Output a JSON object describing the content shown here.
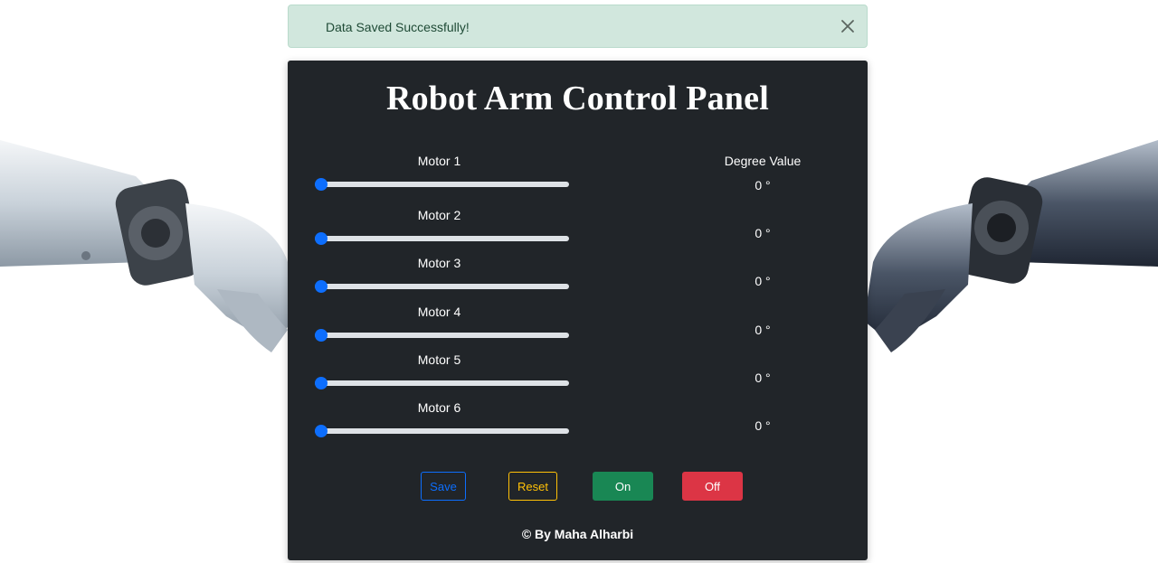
{
  "alert": {
    "message": "Data Saved Successfully!",
    "close_icon": "close-icon"
  },
  "panel": {
    "title": "Robot Arm Control Panel",
    "degree_header": "Degree Value",
    "motors": [
      {
        "label": "Motor 1",
        "degree": "0 °",
        "value": 0
      },
      {
        "label": "Motor 2",
        "degree": "0 °",
        "value": 0
      },
      {
        "label": "Motor 3",
        "degree": "0 °",
        "value": 0
      },
      {
        "label": "Motor 4",
        "degree": "0 °",
        "value": 0
      },
      {
        "label": "Motor 5",
        "degree": "0 °",
        "value": 0
      },
      {
        "label": "Motor 6",
        "degree": "0 °",
        "value": 0
      }
    ],
    "buttons": {
      "save": "Save",
      "reset": "Reset",
      "on": "On",
      "off": "Off"
    },
    "footer": "© By Maha Alharbi"
  },
  "colors": {
    "alert_bg": "#d1e7dd",
    "panel_bg": "#212529",
    "primary": "#0d6efd",
    "warning": "#ffc107",
    "success": "#198754",
    "danger": "#dc3545"
  }
}
